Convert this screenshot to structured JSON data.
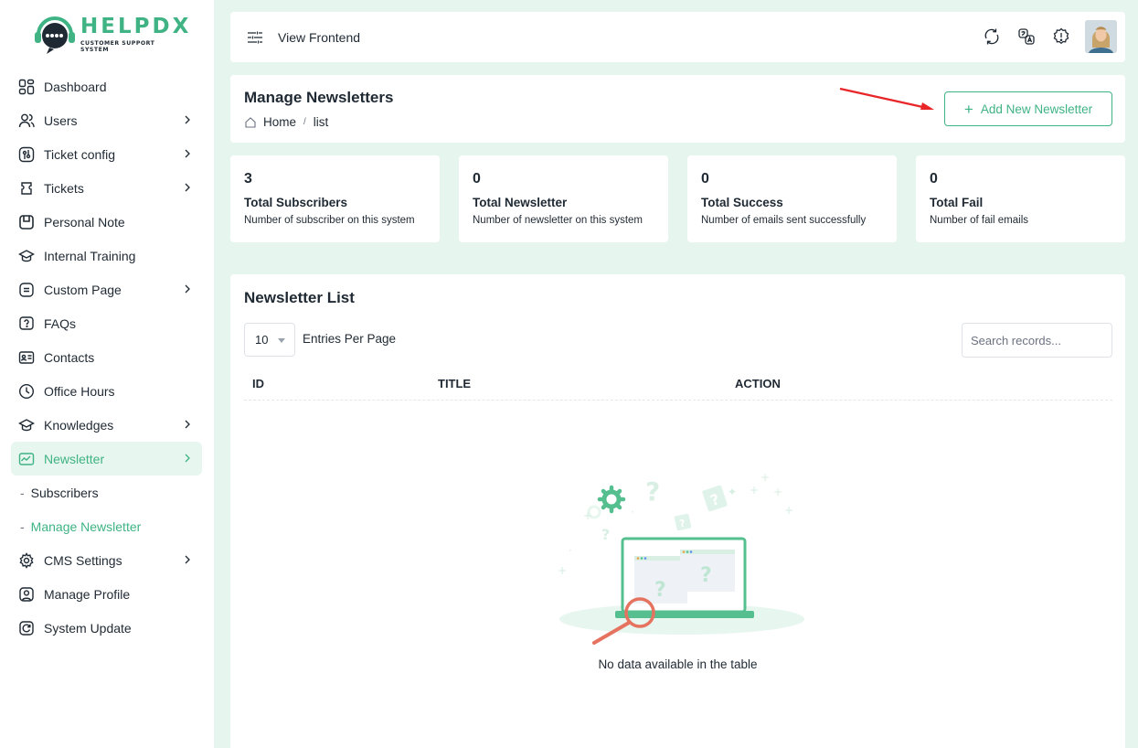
{
  "brand": {
    "name": "HELPDX",
    "tagline": "CUSTOMER SUPPORT SYSTEM"
  },
  "colors": {
    "accent": "#3fb383",
    "accent_light": "#e7f6ef",
    "background": "#e6f5ee",
    "arrow": "#e8262a"
  },
  "sidebar": {
    "items": [
      {
        "label": "Dashboard",
        "icon": "dashboard-icon",
        "has_chevron": false
      },
      {
        "label": "Users",
        "icon": "users-icon",
        "has_chevron": true
      },
      {
        "label": "Ticket config",
        "icon": "ticket-config-icon",
        "has_chevron": true
      },
      {
        "label": "Tickets",
        "icon": "tickets-icon",
        "has_chevron": true
      },
      {
        "label": "Personal Note",
        "icon": "note-icon",
        "has_chevron": false
      },
      {
        "label": "Internal Training",
        "icon": "training-icon",
        "has_chevron": false
      },
      {
        "label": "Custom Page",
        "icon": "page-icon",
        "has_chevron": true
      },
      {
        "label": "FAQs",
        "icon": "faq-icon",
        "has_chevron": false
      },
      {
        "label": "Contacts",
        "icon": "contacts-icon",
        "has_chevron": false
      },
      {
        "label": "Office Hours",
        "icon": "clock-icon",
        "has_chevron": false
      },
      {
        "label": "Knowledges",
        "icon": "knowledge-icon",
        "has_chevron": true
      },
      {
        "label": "Newsletter",
        "icon": "newsletter-icon",
        "has_chevron": true,
        "active": true
      }
    ],
    "sub_items": [
      {
        "label": "Subscribers"
      },
      {
        "label": "Manage Newsletter",
        "active": true
      }
    ],
    "bottom_items": [
      {
        "label": "CMS Settings",
        "icon": "gear-icon",
        "has_chevron": true
      },
      {
        "label": "Manage Profile",
        "icon": "profile-icon",
        "has_chevron": false
      },
      {
        "label": "System Update",
        "icon": "update-icon",
        "has_chevron": false
      }
    ]
  },
  "topbar": {
    "view_frontend": "View Frontend",
    "icons": [
      "sync-icon",
      "translate-icon",
      "info-icon",
      "avatar"
    ]
  },
  "page": {
    "title": "Manage Newsletters",
    "breadcrumb": [
      "Home",
      "list"
    ],
    "add_button": "Add New Newsletter"
  },
  "stats": [
    {
      "value": "3",
      "label": "Total Subscribers",
      "desc": "Number of subscriber on this system"
    },
    {
      "value": "0",
      "label": "Total Newsletter",
      "desc": "Number of newsletter on this system"
    },
    {
      "value": "0",
      "label": "Total Success",
      "desc": "Number of emails sent successfully"
    },
    {
      "value": "0",
      "label": "Total Fail",
      "desc": "Number of fail emails"
    }
  ],
  "list": {
    "title": "Newsletter List",
    "per_page": "10",
    "per_page_label": "Entries Per Page",
    "search_placeholder": "Search records...",
    "columns": [
      "ID",
      "TITLE",
      "ACTION"
    ],
    "empty_text": "No data available in the table"
  }
}
